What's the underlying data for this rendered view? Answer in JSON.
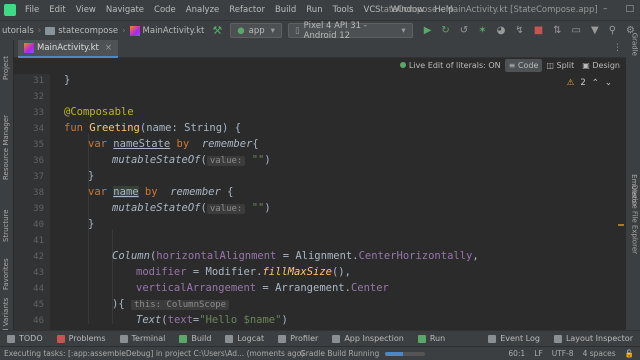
{
  "menu": {
    "items": [
      "File",
      "Edit",
      "View",
      "Navigate",
      "Code",
      "Analyze",
      "Refactor",
      "Build",
      "Run",
      "Tools",
      "VCS",
      "Window",
      "Help"
    ],
    "title": "StateCompose - MainActivity.kt [StateCompose.app]"
  },
  "navbar": {
    "crumbs": [
      "utorials",
      "statecompose",
      "MainActivity.kt"
    ],
    "run_config": "app",
    "device": "Pixel 4 API 31 - Android 12"
  },
  "tabs": {
    "file_tab": "MainActivity.kt"
  },
  "editor_toolbar": {
    "live_edit": "Live Edit of literals: ON",
    "code": "Code",
    "split": "Split",
    "design": "Design",
    "warning_count": "2"
  },
  "side_tabs": {
    "left": [
      "Project",
      "Resource Manager",
      "Structure",
      "Favorites",
      "Build Variants"
    ],
    "right": [
      "Gradle",
      "Emulator",
      "Device File Explorer"
    ]
  },
  "gutter": {
    "line_numbers": [
      "31",
      "32",
      "33",
      "34",
      "35",
      "36",
      "37",
      "38",
      "39",
      "40",
      "41",
      "42",
      "43",
      "44",
      "45",
      "46"
    ]
  },
  "code": {
    "l31": "}",
    "l33_annotation": "@Composable",
    "l34_fun": "fun ",
    "l34_name": "Greeting",
    "l34_params": "(name: String) {",
    "l35_var": "var ",
    "l35_prop": "nameState",
    "l35_by": " by ",
    "l35_remember": "remember",
    "l35_brace": "{",
    "l36_call": "mutableStateOf",
    "l36_hint": "value:",
    "l36_str": "\"\"",
    "l37": "}",
    "l38_var": "var ",
    "l38_prop": "name",
    "l38_by": " by ",
    "l38_remember": "remember",
    "l38_brace": " {",
    "l39_call": "mutableStateOf",
    "l39_hint": "value:",
    "l39_str": "\"\"",
    "l40": "}",
    "l42_column": "Column",
    "l42_arg": "horizontalAlignment",
    "l42_eq": " = Alignment.",
    "l42_val": "CenterHorizontally",
    "l43_arg": "modifier",
    "l43_eq": " = Modifier.",
    "l43_fn": "fillMaxSize",
    "l43_end": "(),",
    "l44_arg": "verticalArrangement",
    "l44_eq": " = Arrangement.",
    "l44_val": "Center",
    "l45_brace": "){",
    "l45_hint": "this: ColumnScope",
    "l46_text": "Text",
    "l46_arg": "text",
    "l46_str": "\"Hello $name\"",
    "l46_end": ")"
  },
  "toolwindows": {
    "left": [
      "TODO",
      "Problems",
      "Terminal",
      "Build",
      "Logcat",
      "Profiler",
      "App Inspection",
      "Run"
    ],
    "right": [
      "Event Log",
      "Layout Inspector"
    ]
  },
  "status": {
    "message": "Executing tasks: [:app:assembleDebug] in project C:\\Users\\Ad... (moments ago)",
    "task": "Gradle Build Running",
    "progress": 0.45,
    "position": "60:1",
    "line_ending": "LF",
    "encoding": "UTF-8",
    "indent": "4 spaces"
  },
  "colors": {
    "keyword": "#cc7832",
    "annotation": "#bbb529",
    "function": "#ffc66d",
    "string": "#6a8759",
    "property": "#9876aa",
    "default_text": "#a9b7c6"
  }
}
